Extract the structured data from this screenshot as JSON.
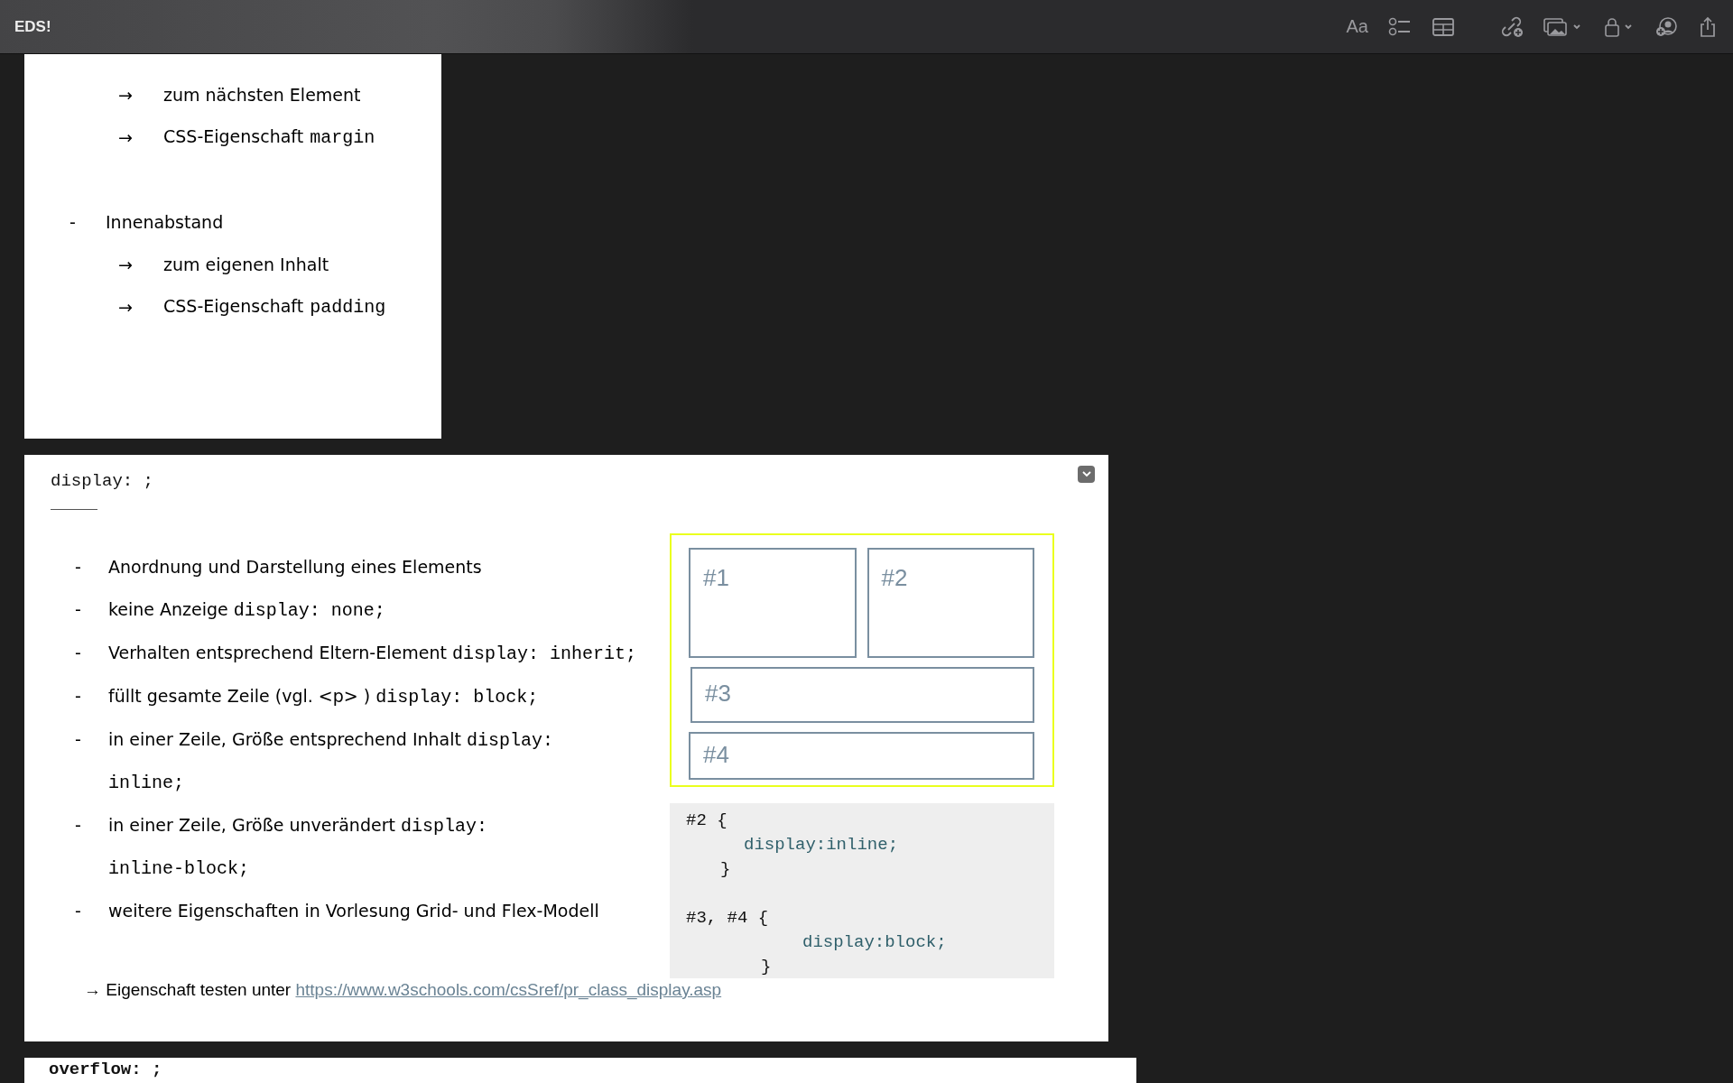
{
  "toolbar": {
    "title": "EDS!",
    "format_label": "Aa"
  },
  "box_model_card": {
    "sections": [
      {
        "points": [
          {
            "text": "zum nächsten Element"
          },
          {
            "text": "CSS-Eigenschaft",
            "code": "margin"
          }
        ]
      },
      {
        "label": "Innenabstand",
        "points": [
          {
            "text": "zum eigenen Inhalt"
          },
          {
            "text": "CSS-Eigenschaft",
            "code": "padding"
          }
        ]
      }
    ],
    "arrow": "→",
    "dash": "-"
  },
  "display_card": {
    "heading": "display: ;",
    "dash": "-",
    "items": [
      {
        "text": "Anordnung und Darstellung eines Elements"
      },
      {
        "text": "keine Anzeige",
        "code_lines": [
          "display: none;"
        ]
      },
      {
        "text": "Verhalten entsprechend Eltern-Element",
        "code_lines": [
          "display: inherit;"
        ]
      },
      {
        "text": "füllt gesamte Zeile (vgl. <p> )",
        "code_lines": [
          "display: block;"
        ]
      },
      {
        "text": "in einer Zeile, Größe entsprechend Inhalt",
        "code_lines": [
          "display:",
          "inline;"
        ]
      },
      {
        "text": "in einer Zeile, Größe unverändert",
        "code_lines": [
          "display:",
          "inline-block;"
        ]
      },
      {
        "text": "weitere Eigenschaften in Vorlesung Grid- und Flex-Modell"
      }
    ],
    "demo_boxes": [
      "#1",
      "#2",
      "#3",
      "#4"
    ],
    "code_lines": [
      {
        "kind": "selector",
        "text": "#2 {"
      },
      {
        "kind": "property",
        "text": "display:inline;"
      },
      {
        "kind": "brace",
        "text": "}"
      },
      {
        "kind": "blank"
      },
      {
        "kind": "selector",
        "text": "#3, #4 {"
      },
      {
        "kind": "property2",
        "text": "display:block;"
      },
      {
        "kind": "brace2",
        "text": "}"
      }
    ],
    "footer_arrow": "→",
    "footer_text": "Eigenschaft testen unter",
    "link": "https://www.w3schools.com/csSref/pr_class_display.asp"
  },
  "next_card": {
    "heading": "overflow: ;"
  }
}
